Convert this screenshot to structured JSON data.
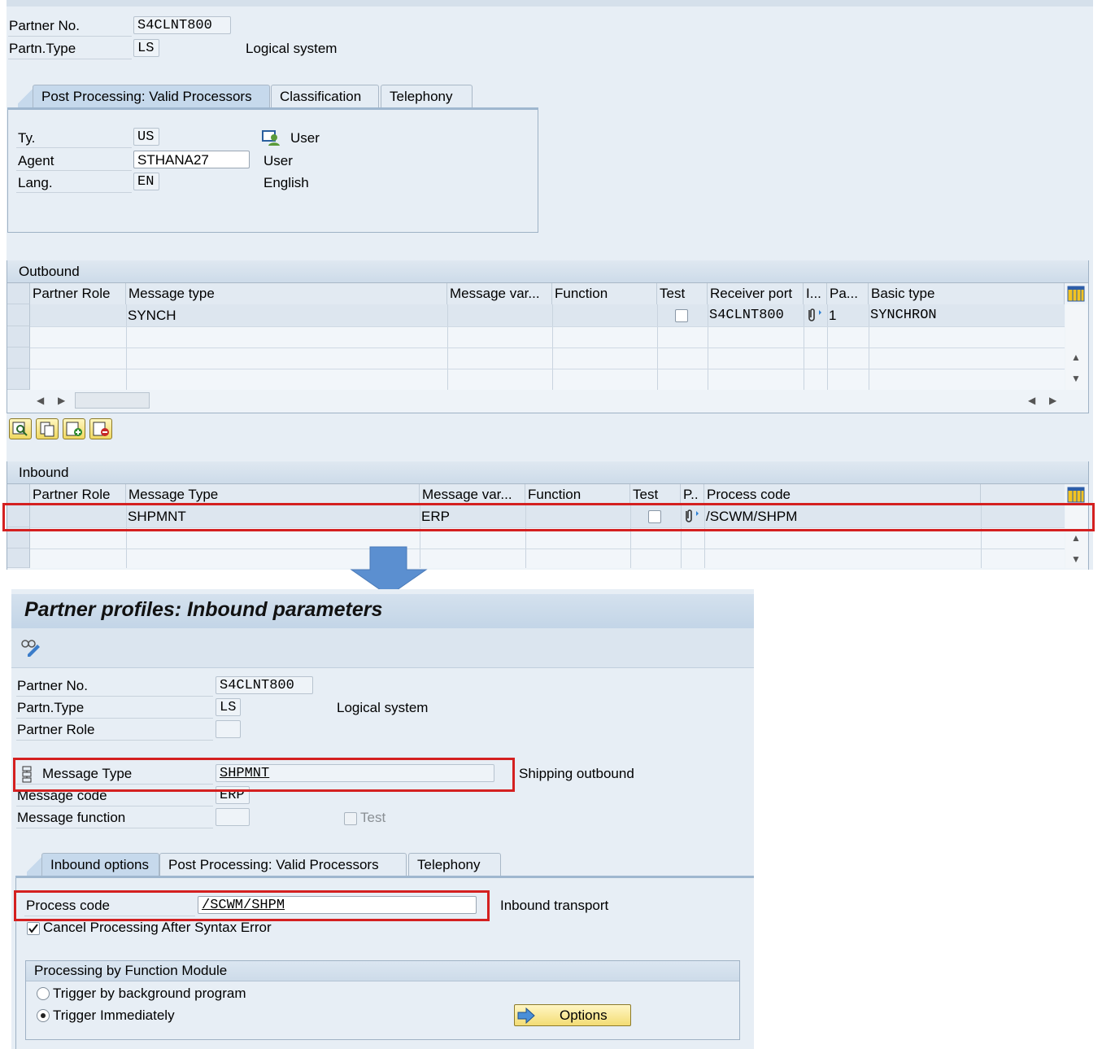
{
  "top": {
    "partner_no_label": "Partner No.",
    "partner_no_value": "S4CLNT800",
    "partn_type_label": "Partn.Type",
    "partn_type_value": "LS",
    "partn_type_desc": "Logical system",
    "tabs": [
      "Post Processing: Valid Processors",
      "Classification",
      "Telephony"
    ],
    "ty_label": "Ty.",
    "ty_value": "US",
    "ty_desc": "User",
    "agent_label": "Agent",
    "agent_value": "STHANA27",
    "agent_desc": "User",
    "lang_label": "Lang.",
    "lang_value": "EN",
    "lang_desc": "English"
  },
  "outbound": {
    "title": "Outbound",
    "columns": [
      "Partner Role",
      "Message type",
      "Message var...",
      "Function",
      "Test",
      "Receiver port",
      "I...",
      "Pa...",
      "Basic type"
    ],
    "row": {
      "partner_role": "",
      "message_type": "SYNCH",
      "message_var": "",
      "function": "",
      "receiver_port": "S4CLNT800",
      "pa": "1",
      "basic_type": "SYNCHRON"
    }
  },
  "inbound": {
    "title": "Inbound",
    "columns": [
      "Partner Role",
      "Message Type",
      "Message var...",
      "Function",
      "Test",
      "P..",
      "Process code"
    ],
    "row": {
      "partner_role": "",
      "message_type": "SHPMNT",
      "message_var": "ERP",
      "function": "",
      "process_code": "/SCWM/SHPM"
    }
  },
  "detail": {
    "title": "Partner profiles: Inbound parameters",
    "partner_no_label": "Partner No.",
    "partner_no_value": "S4CLNT800",
    "partn_type_label": "Partn.Type",
    "partn_type_value": "LS",
    "partn_type_desc": "Logical system",
    "partner_role_label": "Partner Role",
    "message_type_label": "Message Type",
    "message_type_value": "SHPMNT",
    "message_type_desc": "Shipping outbound",
    "message_code_label": "Message code",
    "message_code_value": "ERP",
    "message_function_label": "Message function",
    "test_label": "Test",
    "tabs": [
      "Inbound options",
      "Post Processing: Valid Processors",
      "Telephony"
    ],
    "process_code_label": "Process code",
    "process_code_value": "/SCWM/SHPM",
    "process_code_desc": "Inbound transport",
    "cancel_processing_label": "Cancel Processing After Syntax Error",
    "fm_group_title": "Processing by Function Module",
    "trigger_bg_label": "Trigger by background program",
    "trigger_imm_label": "Trigger Immediately",
    "options_button": "Options"
  },
  "colors": {
    "highlight_red": "#d42020",
    "sap_bg": "#e7eef5",
    "arrow_blue": "#5b8fd0"
  }
}
